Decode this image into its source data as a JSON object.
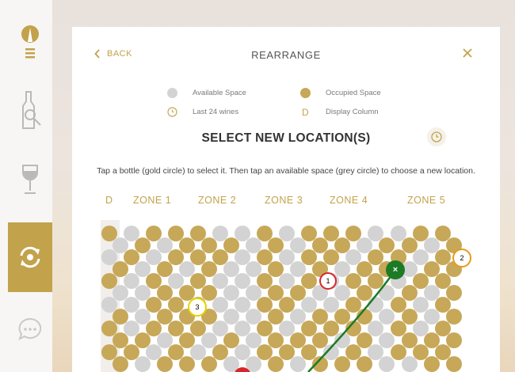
{
  "colors": {
    "gold": "#c2a24b",
    "occupied": "#c7a858",
    "available": "#d3d3d3",
    "select_green": "#1d7a25",
    "red": "#d6262c",
    "yellow": "#e8d200",
    "orange": "#e89a1a"
  },
  "sidebar": {
    "items": [
      {
        "icon": "logo-icon",
        "active": false
      },
      {
        "icon": "bottle-search-icon",
        "active": false
      },
      {
        "icon": "wine-glass-icon",
        "active": false
      },
      {
        "icon": "rearrange-icon",
        "active": true
      },
      {
        "icon": "chat-icon",
        "active": false
      }
    ]
  },
  "header": {
    "back_label": "BACK",
    "title": "REARRANGE",
    "close_icon": "close-icon"
  },
  "legend": {
    "available": "Available Space",
    "occupied": "Occupied Space",
    "last24": "Last 24 wines",
    "display_col_symbol": "D",
    "display_col": "Display Column"
  },
  "main": {
    "title": "SELECT NEW LOCATION(S)",
    "instructions": "Tap a bottle (gold circle) to select it. Then tap an available space (grey circle) to choose a new location."
  },
  "zones": [
    "D",
    "ZONE 1",
    "ZONE 2",
    "ZONE 3",
    "ZONE 4",
    "ZONE 5"
  ],
  "markers": {
    "red": "1",
    "orange": "2",
    "yellow": "3",
    "selected": "×"
  },
  "grid": {
    "rows": [
      "O.OOO..O.OOO..OO",
      ".O.OOO.O.OO.OO.O",
      "O.O.O..O.O.OO.OO",
      "..OOO..OO..O.O.O",
      "O.OOO..O.OOO.O.O",
      "OO.O.O.OOO.O.OOO"
    ]
  }
}
